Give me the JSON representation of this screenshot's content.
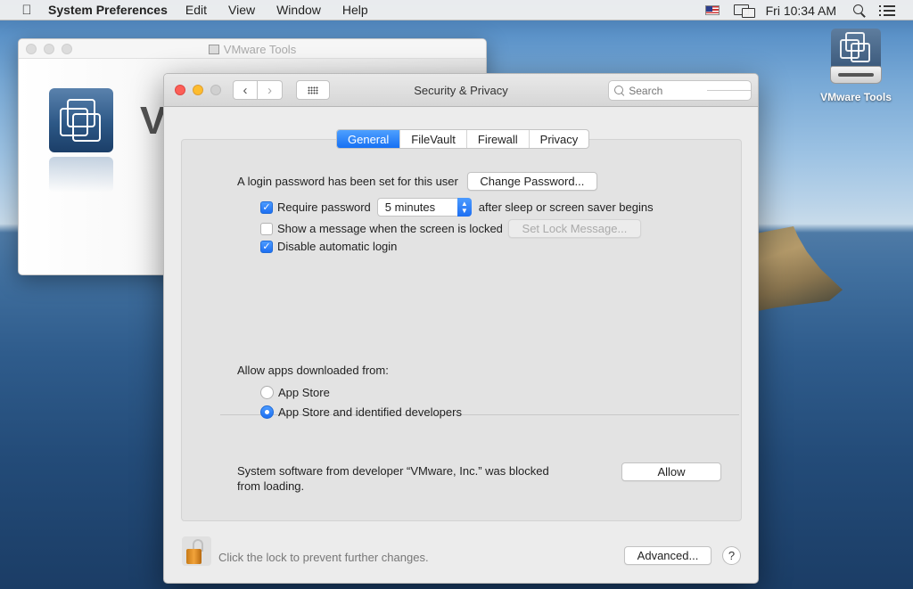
{
  "menubar": {
    "apple_icon": "apple-logo",
    "app_name": "System Preferences",
    "menus": [
      "Edit",
      "View",
      "Window",
      "Help"
    ],
    "status": {
      "input_source_icon": "us-flag",
      "display_icon": "airplay-display",
      "clock": "Fri 10:34 AM",
      "spotlight_icon": "search",
      "notification_icon": "list"
    }
  },
  "desktop": {
    "icons": [
      {
        "label": "VMware Tools",
        "icon": "vmware-disk"
      }
    ]
  },
  "background_window": {
    "title": "VMware Tools",
    "partial_heading": "V"
  },
  "window": {
    "title": "Security & Privacy",
    "search_placeholder": "Search",
    "tabs": [
      {
        "label": "General",
        "active": true
      },
      {
        "label": "FileVault",
        "active": false
      },
      {
        "label": "Firewall",
        "active": false
      },
      {
        "label": "Privacy",
        "active": false
      }
    ],
    "general": {
      "login_password_text": "A login password has been set for this user",
      "change_password_button": "Change Password...",
      "require_password": {
        "label": "Require password",
        "checked": true,
        "value": "5 minutes",
        "suffix": "after sleep or screen saver begins"
      },
      "show_message": {
        "label": "Show a message when the screen is locked",
        "checked": false,
        "button": "Set Lock Message..."
      },
      "disable_auto_login": {
        "label": "Disable automatic login",
        "checked": true
      },
      "allow_apps_label": "Allow apps downloaded from:",
      "allow_options": [
        {
          "label": "App Store",
          "selected": false
        },
        {
          "label": "App Store and identified developers",
          "selected": true
        }
      ],
      "blocked_line1": "System software from developer “VMware, Inc.” was blocked",
      "blocked_line2": "from loading.",
      "allow_button": "Allow"
    },
    "footer": {
      "lock_text": "Click the lock to prevent further changes.",
      "advanced_button": "Advanced...",
      "help_button": "?"
    }
  },
  "colors": {
    "accent": "#1670f3",
    "close": "#fc5f57",
    "minimize": "#fdbc2e"
  }
}
